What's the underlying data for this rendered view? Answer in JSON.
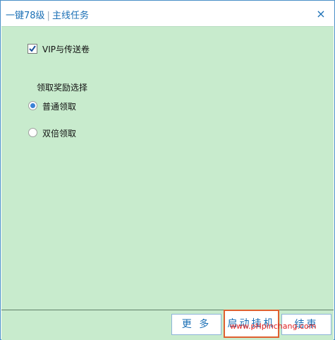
{
  "window": {
    "title_main": "一键78级",
    "title_sep": "|",
    "title_sub": "主线任务",
    "close_glyph": "×"
  },
  "options": {
    "vip_label": "VIP与传送卷",
    "vip_checked": true,
    "reward_section_label": "领取奖励选择",
    "reward_options": [
      {
        "label": "普通领取",
        "selected": true
      },
      {
        "label": "双倍领取",
        "selected": false
      }
    ]
  },
  "footer": {
    "more_label": "更 多",
    "start_label": "启动挂机",
    "end_label": "结束",
    "watermark": "www.pHpinchang.com"
  },
  "colors": {
    "accent": "#1a6fb5",
    "content_bg": "#c8ebcd",
    "radio_dot": "#3b82d6",
    "highlight_border": "#e06030"
  }
}
